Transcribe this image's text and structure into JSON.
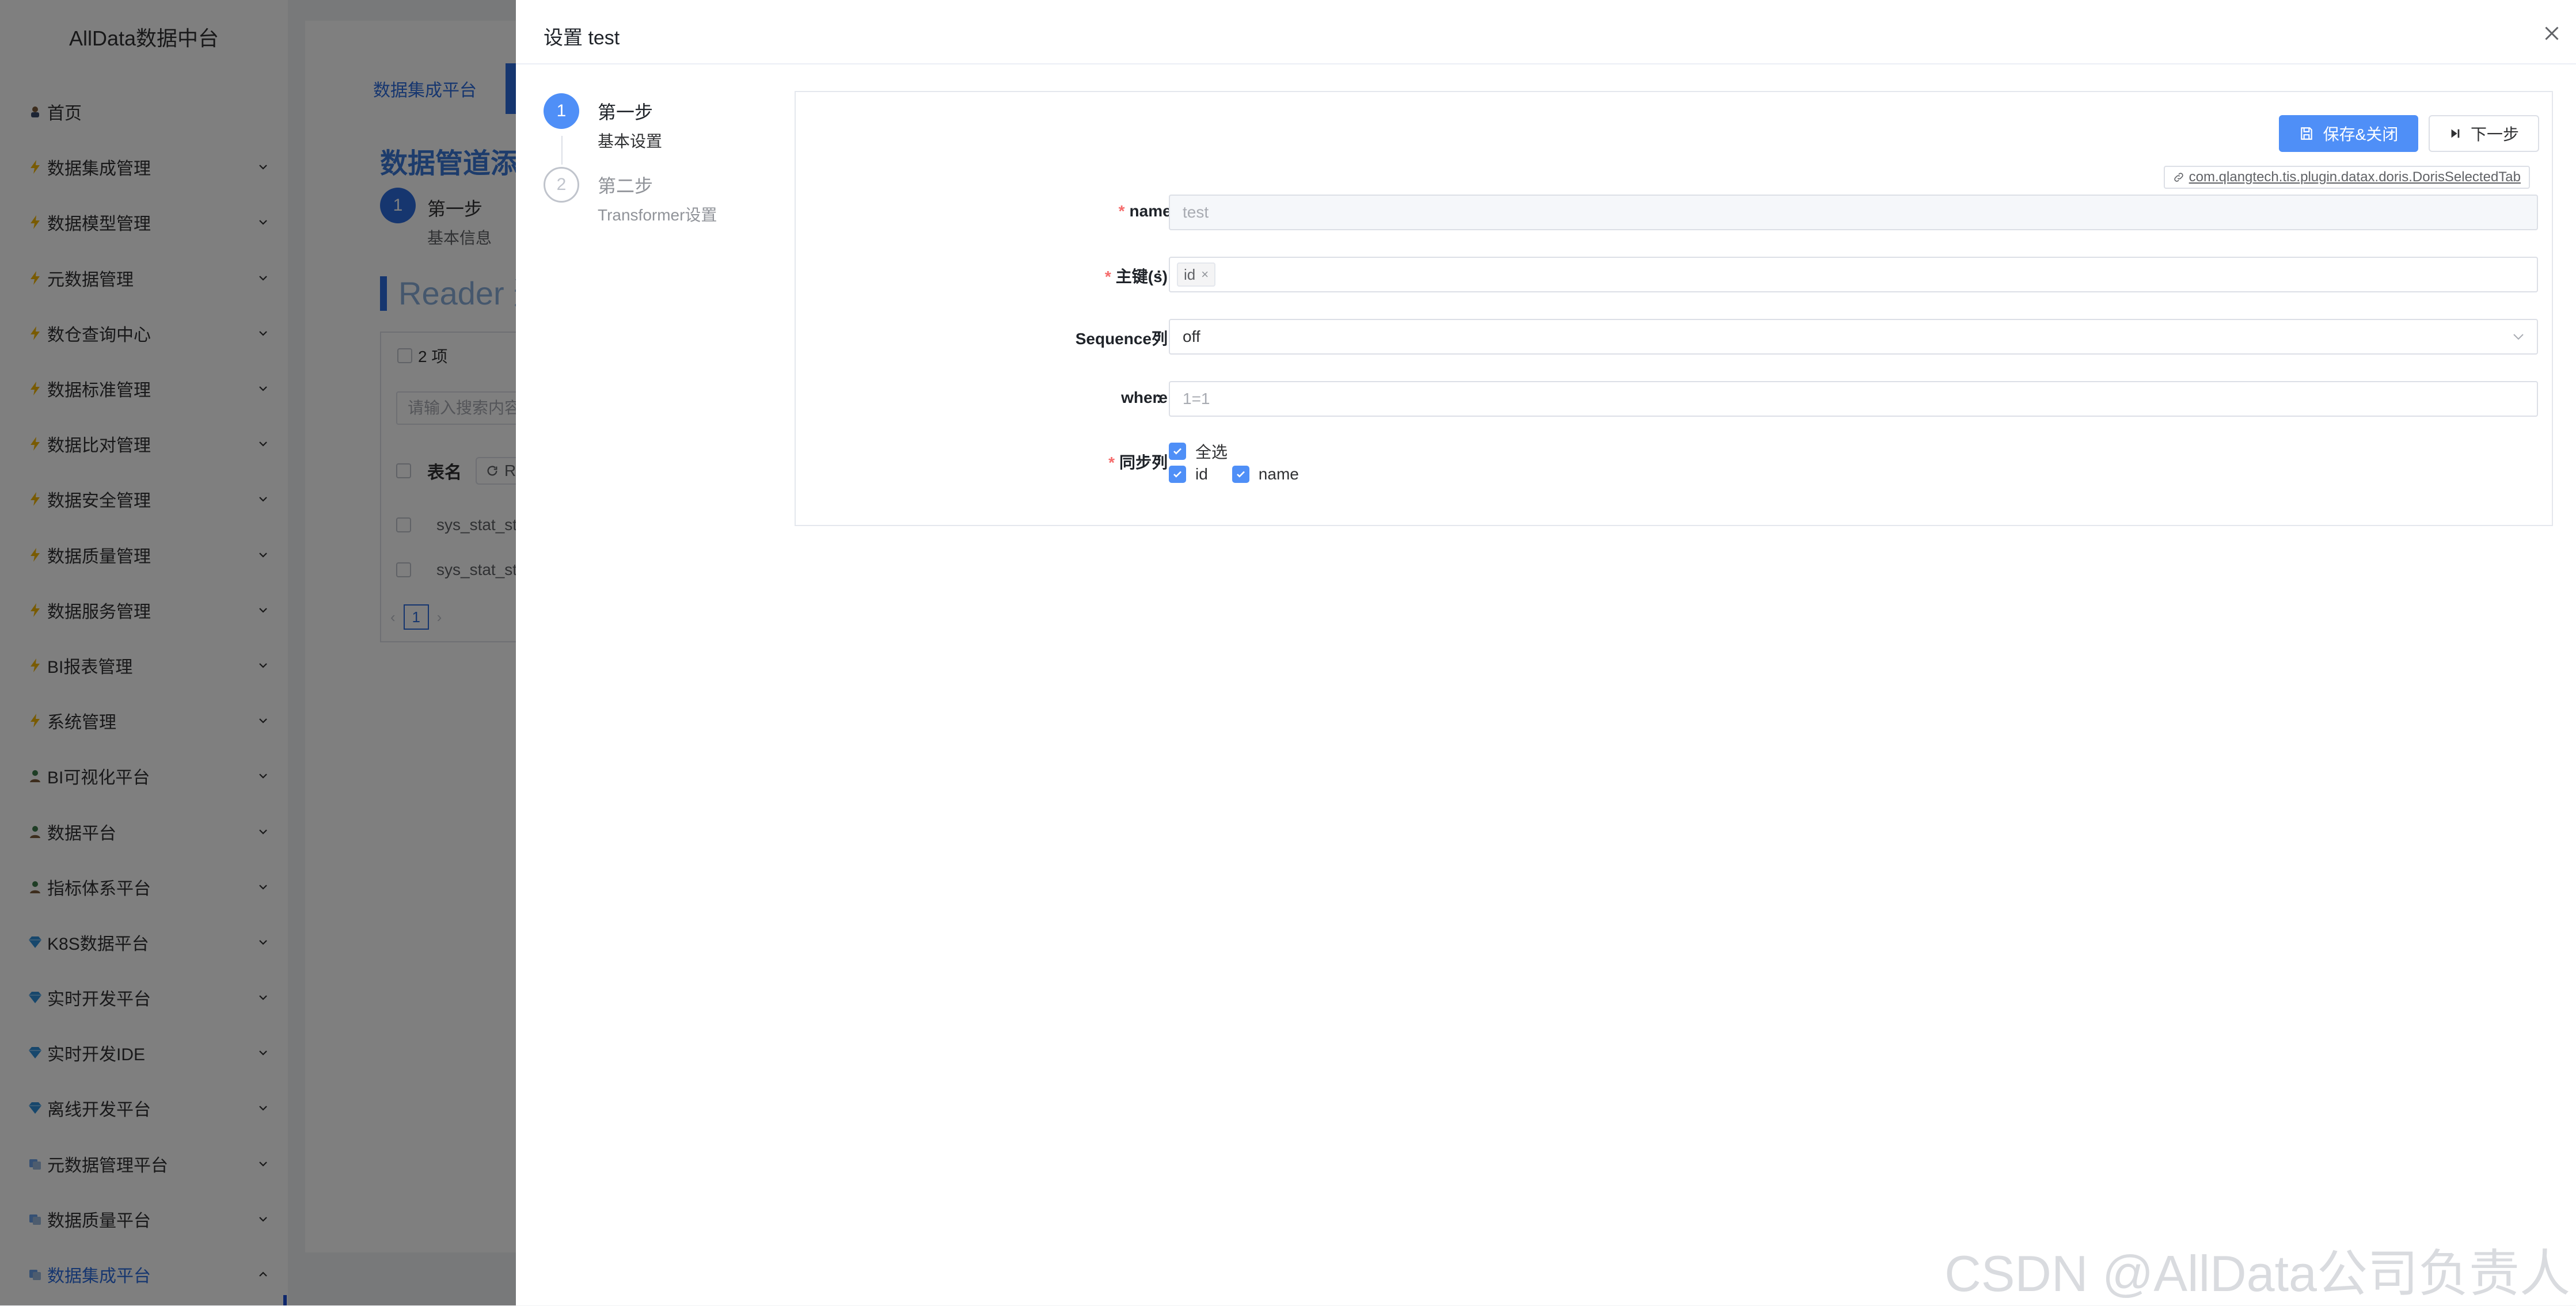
{
  "sidebar": {
    "brand": "AllData数据中台",
    "items": [
      {
        "label": "首页",
        "icon": "home-icon",
        "expand": false
      },
      {
        "label": "数据集成管理",
        "icon": "lightning-icon",
        "expand": true
      },
      {
        "label": "数据模型管理",
        "icon": "lightning-icon",
        "expand": true
      },
      {
        "label": "元数据管理",
        "icon": "lightning-icon",
        "expand": true
      },
      {
        "label": "数仓查询中心",
        "icon": "lightning-icon",
        "expand": true
      },
      {
        "label": "数据标准管理",
        "icon": "lightning-icon",
        "expand": true
      },
      {
        "label": "数据比对管理",
        "icon": "lightning-icon",
        "expand": true
      },
      {
        "label": "数据安全管理",
        "icon": "lightning-icon",
        "expand": true
      },
      {
        "label": "数据质量管理",
        "icon": "lightning-icon",
        "expand": true
      },
      {
        "label": "数据服务管理",
        "icon": "lightning-icon",
        "expand": true
      },
      {
        "label": "BI报表管理",
        "icon": "lightning-icon",
        "expand": true
      },
      {
        "label": "系统管理",
        "icon": "lightning-icon",
        "expand": true
      },
      {
        "label": "BI可视化平台",
        "icon": "person-icon",
        "expand": true
      },
      {
        "label": "数据平台",
        "icon": "person-icon",
        "expand": true
      },
      {
        "label": "指标体系平台",
        "icon": "person-icon",
        "expand": true
      },
      {
        "label": "K8S数据平台",
        "icon": "diamond-icon",
        "expand": true
      },
      {
        "label": "实时开发平台",
        "icon": "diamond-icon",
        "expand": true
      },
      {
        "label": "实时开发IDE",
        "icon": "diamond-icon",
        "expand": true
      },
      {
        "label": "离线开发平台",
        "icon": "diamond-icon",
        "expand": true
      },
      {
        "label": "元数据管理平台",
        "icon": "layers-icon",
        "expand": true
      },
      {
        "label": "数据质量平台",
        "icon": "layers-icon",
        "expand": true
      },
      {
        "label": "数据集成平台",
        "icon": "layers-icon",
        "expand": true,
        "active": true
      }
    ]
  },
  "background": {
    "tab_label": "数据集成平台",
    "page_title": "数据管道添加",
    "step_number": "1",
    "step_title": "第一步",
    "step_desc": "基本信息",
    "reader_title": "Reader 选",
    "count_label": "2 项",
    "search_placeholder": "请输入搜索内容",
    "table_header": "表名",
    "refresh_label": "Re",
    "rows": [
      "sys_stat_stat",
      "sys_stat_stat"
    ],
    "page": "1"
  },
  "drawer": {
    "title": "设置 test",
    "steps": [
      {
        "number": "1",
        "title": "第一步",
        "desc": "基本设置"
      },
      {
        "number": "2",
        "title": "第二步",
        "desc": "Transformer设置"
      }
    ],
    "buttons": {
      "save": "保存&关闭",
      "next": "下一步"
    },
    "plugin": "com.qlangtech.tis.plugin.datax.doris.DorisSelectedTab",
    "form": {
      "name_label": "name",
      "name_colon": ":",
      "name_value": "test",
      "pk_label": "主键(s)",
      "pk_tag": "id",
      "seq_label": "Sequence列",
      "seq_value": "off",
      "where_label": "where",
      "where_placeholder": "1=1",
      "sync_label": "同步列",
      "colon": ":",
      "select_all": "全选",
      "columns": [
        "id",
        "name"
      ]
    }
  },
  "watermark": "CSDN @AllData公司负责人",
  "colors": {
    "primary": "#4f8ff7",
    "required": "#f56c6c",
    "mask": "rgba(0,0,0,0.5)"
  }
}
